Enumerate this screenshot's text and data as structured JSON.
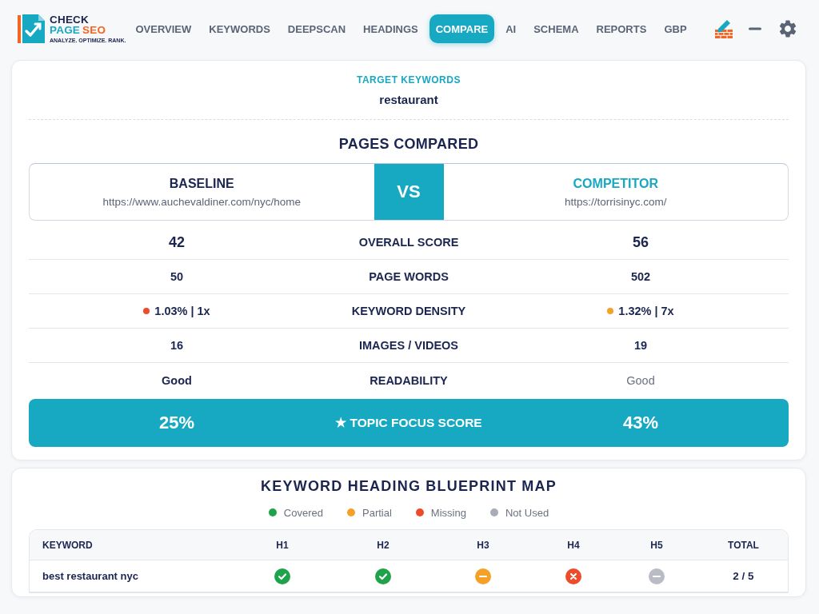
{
  "logo": {
    "line_1": "CHECK",
    "line_2": [
      "PAGE",
      "SEO"
    ],
    "tagline": "ANALYZE. OPTIMIZE. RANK."
  },
  "nav": {
    "tabs": [
      {
        "label": "OVERVIEW",
        "selected": false
      },
      {
        "label": "KEYWORDS",
        "selected": false
      },
      {
        "label": "DEEPSCAN",
        "selected": false
      },
      {
        "label": "HEADINGS",
        "selected": false
      },
      {
        "label": "COMPARE",
        "selected": true
      },
      {
        "label": "AI",
        "selected": false
      },
      {
        "label": "SCHEMA",
        "selected": false
      },
      {
        "label": "REPORTS",
        "selected": false
      },
      {
        "label": "GBP",
        "selected": false
      }
    ]
  },
  "target": {
    "heading": "TARGET KEYWORDS",
    "keyword": "restaurant"
  },
  "pages_compared": {
    "title": "PAGES COMPARED",
    "baseline": {
      "title": "BASELINE",
      "url": "https://www.auchevaldiner.com/nyc/home"
    },
    "vs": "VS",
    "competitor": {
      "title": "COMPETITOR",
      "url": "https://torrisinyc.com/"
    }
  },
  "metrics": [
    {
      "kind": "score",
      "label": "OVERALL SCORE",
      "baseline": {
        "value": "42",
        "muted": false
      },
      "competitor": {
        "value": "56",
        "muted": false
      }
    },
    {
      "kind": "plain",
      "label": "PAGE WORDS",
      "baseline": {
        "value": "50",
        "muted": false
      },
      "competitor": {
        "value": "502",
        "muted": false
      }
    },
    {
      "kind": "plain",
      "label": "KEYWORD DENSITY",
      "baseline": {
        "value": "1.03% | 1x",
        "muted": false,
        "color": "#ee4b2b"
      },
      "competitor": {
        "value": "1.32% | 7x",
        "muted": false,
        "color": "#f5a128"
      }
    },
    {
      "kind": "plain",
      "label": "IMAGES / VIDEOS",
      "baseline": {
        "value": "16",
        "muted": false
      },
      "competitor": {
        "value": "19",
        "muted": false
      }
    },
    {
      "kind": "plain",
      "label": "READABILITY",
      "baseline": {
        "value": "Good",
        "muted": false
      },
      "competitor": {
        "value": "Good",
        "muted": true
      }
    }
  ],
  "topic_focus": {
    "label": "★ TOPIC FOCUS SCORE",
    "baseline": "25%",
    "competitor": "43%"
  },
  "blueprint": {
    "title": "KEYWORD HEADING BLUEPRINT MAP",
    "legend": [
      {
        "label": "Covered",
        "color": "#1fa34a"
      },
      {
        "label": "Partial",
        "color": "#f5a128"
      },
      {
        "label": "Missing",
        "color": "#ee4b2b"
      },
      {
        "label": "Not Used",
        "color": "#a8acb6"
      }
    ],
    "columns": [
      "KEYWORD",
      "H1",
      "H2",
      "H3",
      "H4",
      "H5",
      "TOTAL"
    ],
    "rows": [
      {
        "keyword": "best restaurant nyc",
        "cells": [
          {
            "kind": "covered"
          },
          {
            "kind": "covered"
          },
          {
            "kind": "partial"
          },
          {
            "kind": "missing"
          },
          {
            "kind": "unused"
          }
        ],
        "total": "2 / 5"
      }
    ]
  }
}
